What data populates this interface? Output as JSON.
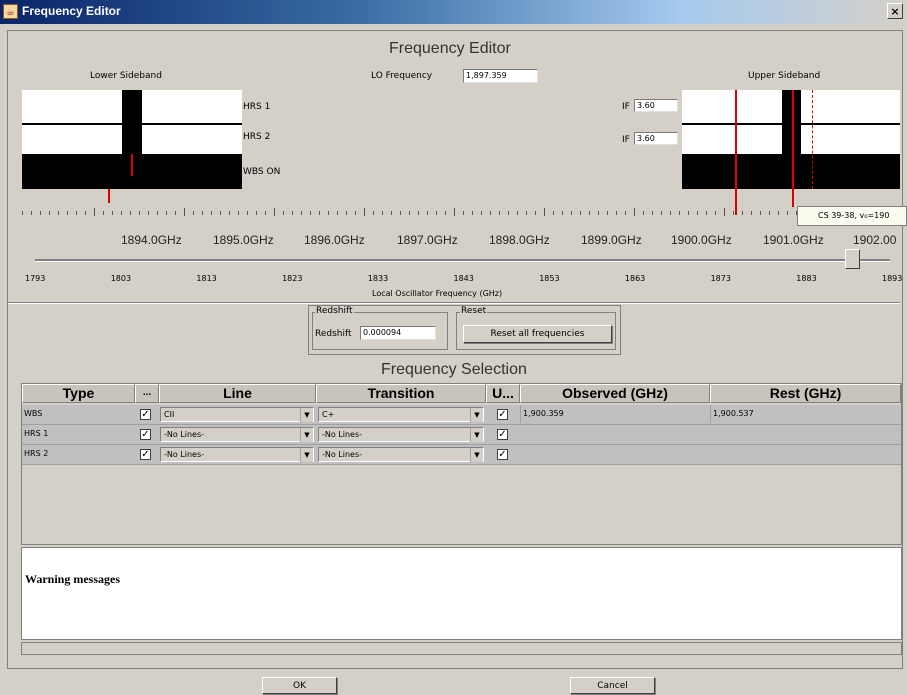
{
  "window": {
    "title": "Frequency Editor",
    "close_glyph": "×",
    "app_icon": "java-cup-icon"
  },
  "editor": {
    "heading": "Frequency Editor",
    "lower_sideband": "Lower Sideband",
    "upper_sideband": "Upper Sideband",
    "lo_frequency_label": "LO Frequency",
    "lo_frequency_value": "1,897.359",
    "rows": [
      {
        "label": "HRS 1",
        "if_label": "IF",
        "if_value": "3.60"
      },
      {
        "label": "HRS 2",
        "if_label": "IF",
        "if_value": "3.60"
      },
      {
        "label": "WBS ON"
      }
    ],
    "tooltip": "CS 39-38, v₀=190",
    "ghz_ticks": [
      "1894.0GHz",
      "1895.0GHz",
      "1896.0GHz",
      "1897.0GHz",
      "1898.0GHz",
      "1899.0GHz",
      "1900.0GHz",
      "1901.0GHz",
      "1902.00"
    ],
    "slider_ticks": [
      "1793",
      "1803",
      "1813",
      "1823",
      "1833",
      "1843",
      "1853",
      "1863",
      "1873",
      "1883",
      "1893"
    ],
    "slider_title": "Local Oscillator Frequency (GHz)",
    "redshift_group": "Redshift",
    "redshift_label": "Redshift",
    "redshift_value": "0.000094",
    "reset_group": "Reset",
    "reset_button": "Reset all frequencies"
  },
  "selection": {
    "heading": "Frequency Selection",
    "columns": [
      "Type",
      "...",
      "Line",
      "Transition",
      "U...",
      "Observed (GHz)",
      "Rest (GHz)"
    ],
    "rows": [
      {
        "type": "WBS",
        "line": "CII",
        "transition": "C+",
        "observed": "1,900.359",
        "rest": "1,900.537"
      },
      {
        "type": "HRS 1",
        "line": "-No Lines-",
        "transition": "-No Lines-",
        "observed": "",
        "rest": ""
      },
      {
        "type": "HRS 2",
        "line": "-No Lines-",
        "transition": "-No Lines-",
        "observed": "",
        "rest": ""
      }
    ],
    "check_glyph": "✓",
    "arrow_glyph": "▼"
  },
  "warnings": {
    "title": "Warning messages"
  },
  "buttons": {
    "ok": "OK",
    "cancel": "Cancel"
  }
}
